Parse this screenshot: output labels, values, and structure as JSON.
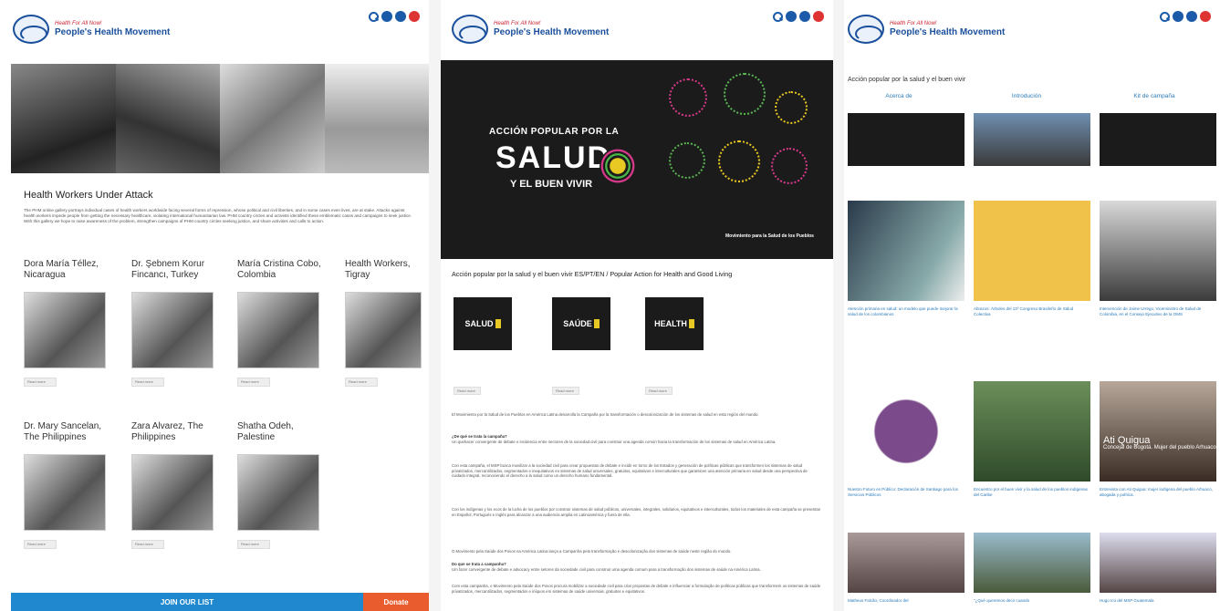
{
  "header": {
    "logo_tagline": "Health For All Now!",
    "logo_name": "People's Health Movement"
  },
  "panel1": {
    "title": "Health Workers Under Attack",
    "description": "The PHM online gallery portrays individual cases of health workers worldwide facing several forms of repression, whose political and civil liberties, and in some cases even lives, are at stake. Attacks against health workers impede people from getting the necessary healthcare, violating international humanitarian law. PHM country circles and activists identified these emblematic cases and campaigns to seek justice. With this gallery we hope to raise awareness of the problem, strengthen campaigns of PHM country circles seeking justice, and share activities and calls to action.",
    "read_more": "Read more",
    "cards": [
      {
        "name": "Dora María Téllez, Nicaragua"
      },
      {
        "name": "Dr. Şebnem Korur Fincancı, Turkey"
      },
      {
        "name": "María Cristina Cobo, Colombia"
      },
      {
        "name": "Health Workers, Tigray"
      },
      {
        "name": "Dr. Mary Sancelan, The Philippines"
      },
      {
        "name": "Zara Alvarez, The Philippines"
      },
      {
        "name": "Shatha Odeh, Palestine"
      }
    ],
    "join_label": "JOIN OUR LIST",
    "donate_label": "Donate"
  },
  "panel2": {
    "hero_line1": "ACCIÓN POPULAR POR LA",
    "hero_salud": "SALUD",
    "hero_line3": "Y EL BUEN VIVIR",
    "hero_org": "Movimiento para la Salud de los Pueblos",
    "title": "Acción popular por la salud y el buen vivir ES/PT/EN / Popular Action for Health and Good Living",
    "thumbs": [
      {
        "label": "SALUD"
      },
      {
        "label": "SAÚDE"
      },
      {
        "label": "HEALTH"
      }
    ],
    "read_more": "Read more",
    "intro": "El Movimiento por la Salud de los Pueblos en América Latina desarrolla la Campaña por la transformación o descolonización de los sistemas de salud en esta región del mundo.",
    "q1": "¿De qué se trata la campaña?",
    "a1": "Un quehacer convergente de debate e incidencia entre sectores de la sociedad civil para construir una agenda común hacia la transformación de los sistemas de salud en América Latina.",
    "p2": "Con esta campaña, el MSP busca movilizar a la sociedad civil para crear propuestas de debate e incidir en torno de los Estados y generación de políticas públicas que transformen los sistemas de salud privatizados, mercantilizados, segmentados e inequitativos en sistemas de salud universales, gratuitos, equitativos e interculturales que garanticen una atención primaria en salud desde una perspectiva de cuidado integral, reconociendo el derecho a la salud como un derecho humano fundamental.",
    "p3": "Con los indígenas y los ecos de la lucha de los pueblos por construir sistemas de salud públicos, universales, integrales, solidarios, equitativos e interculturales, todos los materiales de esta campaña se presentan en Español, Portugués e Inglés para alcanzar a una audiencia amplia en Latinoamérica y fuera de ella.",
    "p4": "O Movimento pela Saúde dos Povos na América Latina lança a Campanha pela transformação e descolonização dos sistemas de saúde neste região do mundo.",
    "q2": "Do que se trata a campanha?",
    "a2": "Um fazer convergente de debate e advocacy entre setores da sociedade civil para construir uma agenda comum para a transformação dos sistemas de saúde na América Latina.",
    "p5": "Com esta campanha, o Movimento pela Saúde dos Povos procura mobilizar a sociedade civil para criar propostas de debate e influenciar a formulação de políticas públicas que transformem os sistemas de saúde privatizados, mercantilizados, segmentados e iníquos em sistemas de saúde universais, gratuitos e equitativos."
  },
  "panel3": {
    "title": "Acción popular por la salud y el buen vivir",
    "tabs": [
      "Acerca de",
      "Introdución",
      "Kit de campaña"
    ],
    "captions": [
      "Atención primaria en salud: un modelo que puede mejorar la salud de los colombianos",
      "Abrazos: Árboles del 13º Congreso Brasileño de Salud Colectiva",
      "Intervención de Jaime Urrego, Viceministro de Salud de Colombia, en el Consejo Ejecutivo de la OMS",
      "Nuestro Futuro es Público: Declaración de Santiago para los Servicios Públicos",
      "Encuentro por el buen vivir y la salud de los pueblos indígenas del Caribe",
      "Entrevista con Ati Quigua: mujer indígena del pueblo Arhuaco, abogada y política.",
      "Matheus Falcão, Coordinador del",
      "\"¿Qué queremos decir cuando",
      "Hugo Icú del MSP Guatemala"
    ],
    "overlay_name": "Ati Quigua",
    "overlay_role": "Concejal de Bogotá. Mujer del pueblo Arhuaco"
  }
}
